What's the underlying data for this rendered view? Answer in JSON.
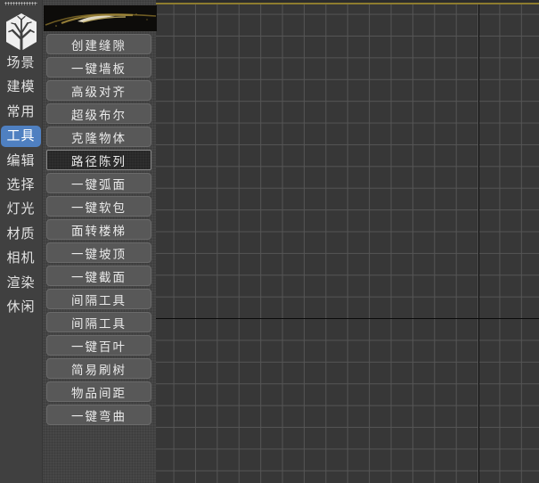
{
  "colors": {
    "accent_blue": "#4f80c1",
    "viewport_bg": "#373737",
    "grid_line": "#555555",
    "axis_line": "#0b0b0b",
    "active_viewport_border": "#8e7c2e",
    "panel_bg": "#474747",
    "button_bg": "#585858",
    "pressed_button_bg": "#2e2e2e"
  },
  "sidebar": {
    "items": [
      "场景",
      "建模",
      "常用",
      "工具",
      "编辑",
      "选择",
      "灯光",
      "材质",
      "相机",
      "渲染",
      "休闲"
    ],
    "active_item": "工具"
  },
  "toolbox": {
    "buttons": [
      "创建缝隙",
      "一键墙板",
      "高级对齐",
      "超级布尔",
      "克隆物体",
      "路径陈列",
      "一键弧面",
      "一键软包",
      "面转楼梯",
      "一键坡顶",
      "一键截面",
      "间隔工具",
      "间隔工具",
      "一键百叶",
      "简易刷树",
      "物品间距",
      "一键弯曲"
    ],
    "pressed_button": "路径陈列"
  },
  "icons": {
    "logo": "tree-hexagon-logo",
    "banner": "gold-swoosh-banner"
  }
}
